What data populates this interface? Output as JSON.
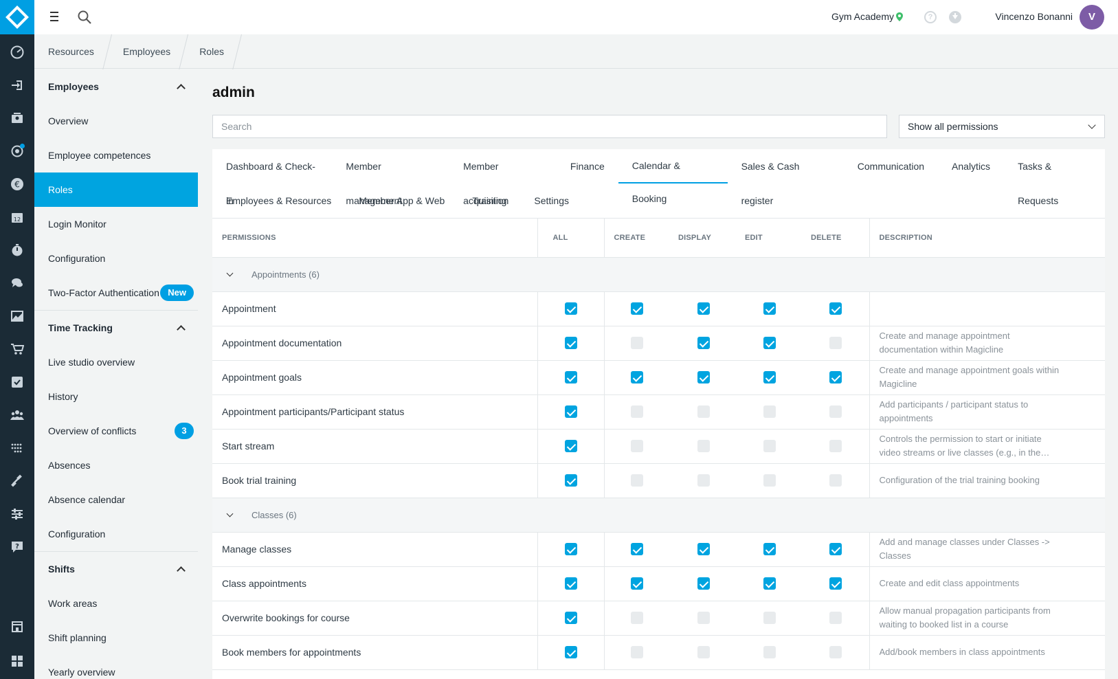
{
  "app": {
    "studio": "Gym Academy",
    "user_name": "Vincenzo Bonanni",
    "avatar_initial": "V",
    "accent": "#009fe3"
  },
  "breadcrumb": [
    "Resources",
    "Employees",
    "Roles"
  ],
  "sidebar": {
    "groups": [
      {
        "title": "Employees",
        "items": [
          {
            "label": "Overview"
          },
          {
            "label": "Employee competences"
          },
          {
            "label": "Roles",
            "active": true
          },
          {
            "label": "Login Monitor"
          },
          {
            "label": "Configuration"
          },
          {
            "label": "Two-Factor Authentication",
            "badge": "New"
          }
        ]
      },
      {
        "title": "Time Tracking",
        "items": [
          {
            "label": "Live studio overview"
          },
          {
            "label": "History"
          },
          {
            "label": "Overview of conflicts",
            "count": "3"
          },
          {
            "label": "Absences"
          },
          {
            "label": "Absence calendar"
          },
          {
            "label": "Configuration"
          }
        ]
      },
      {
        "title": "Shifts",
        "items": [
          {
            "label": "Work areas"
          },
          {
            "label": "Shift planning"
          },
          {
            "label": "Yearly overview"
          }
        ]
      }
    ]
  },
  "page": {
    "title": "admin",
    "search_placeholder": "Search",
    "filter_value": "Show all permissions"
  },
  "tabs": {
    "row1": [
      "Dashboard & Check-in",
      "Member management",
      "Member acquisition",
      "Finance",
      "Calendar & Booking",
      "Sales & Cash register",
      "Communication",
      "Analytics",
      "Tasks & Requests"
    ],
    "row2": [
      "Employees & Resources",
      "Member App & Web",
      "Training",
      "Settings"
    ],
    "active": "Calendar & Booking"
  },
  "table": {
    "headers": {
      "permissions": "PERMISSIONS",
      "all": "ALL",
      "create": "CREATE",
      "display": "DISPLAY",
      "edit": "EDIT",
      "delete": "DELETE",
      "description": "DESCRIPTION"
    },
    "categories": [
      {
        "name": "Appointments (6)",
        "rows": [
          {
            "name": "Appointment",
            "all": true,
            "create": true,
            "display": true,
            "edit": true,
            "delete": true,
            "description": ""
          },
          {
            "name": "Appointment documentation",
            "all": true,
            "create": false,
            "display": true,
            "edit": true,
            "delete": false,
            "description": "Create and manage appointment documentation within Magicline"
          },
          {
            "name": "Appointment goals",
            "all": true,
            "create": true,
            "display": true,
            "edit": true,
            "delete": true,
            "description": "Create and manage appointment goals within Magicline"
          },
          {
            "name": "Appointment participants/Participant status",
            "all": true,
            "create": false,
            "display": false,
            "edit": false,
            "delete": false,
            "description": "Add participants / participant status to appointments"
          },
          {
            "name": "Start stream",
            "all": true,
            "create": false,
            "display": false,
            "edit": false,
            "delete": false,
            "description": "Controls the permission to start or initiate video streams or live classes (e.g., in the…"
          },
          {
            "name": "Book trial training",
            "all": true,
            "create": false,
            "display": false,
            "edit": false,
            "delete": false,
            "description": "Configuration of the trial training booking"
          }
        ]
      },
      {
        "name": "Classes (6)",
        "rows": [
          {
            "name": "Manage classes",
            "all": true,
            "create": true,
            "display": true,
            "edit": true,
            "delete": true,
            "description": "Add and manage classes under Classes -> Classes"
          },
          {
            "name": "Class appointments",
            "all": true,
            "create": true,
            "display": true,
            "edit": true,
            "delete": true,
            "description": "Create and edit class appointments"
          },
          {
            "name": "Overwrite bookings for course",
            "all": true,
            "create": false,
            "display": false,
            "edit": false,
            "delete": false,
            "description": "Allow manual propagation participants from waiting to booked list in a course"
          },
          {
            "name": "Book members for appointments",
            "all": true,
            "create": false,
            "display": false,
            "edit": false,
            "delete": false,
            "description": "Add/book members in class appointments"
          }
        ]
      }
    ]
  },
  "rail_icons": [
    "dashboard-icon",
    "check-in-icon",
    "members-icon",
    "acquisition-icon",
    "finance-icon",
    "calendar-icon",
    "timer-icon",
    "chat-icon",
    "analytics-icon",
    "cart-icon",
    "tasks-icon",
    "employees-icon",
    "devices-icon",
    "training-icon",
    "settings-icon",
    "support-icon",
    "store-icon",
    "apps-icon"
  ]
}
